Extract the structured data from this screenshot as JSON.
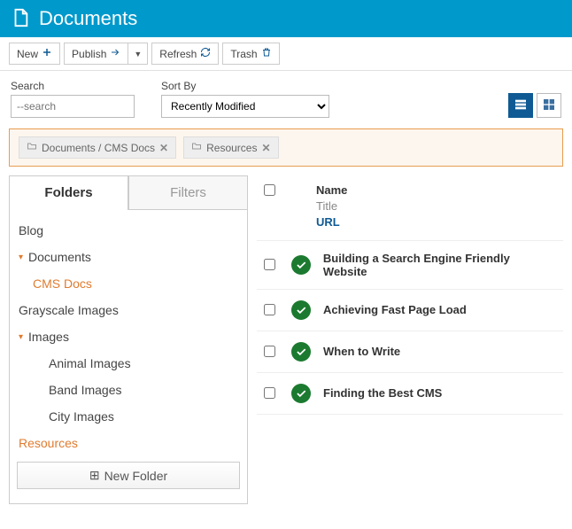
{
  "header": {
    "title": "Documents"
  },
  "toolbar": {
    "new": "New",
    "publish": "Publish",
    "refresh": "Refresh",
    "trash": "Trash"
  },
  "filters": {
    "search_label": "Search",
    "search_placeholder": "--search",
    "sort_label": "Sort By",
    "sort_value": "Recently Modified"
  },
  "chips": [
    "Documents / CMS Docs",
    "Resources"
  ],
  "tabs": {
    "folders": "Folders",
    "filters": "Filters"
  },
  "tree": {
    "blog": "Blog",
    "documents": "Documents",
    "cms_docs": "CMS Docs",
    "grayscale": "Grayscale Images",
    "images": "Images",
    "animal": "Animal Images",
    "band": "Band Images",
    "city": "City Images",
    "resources": "Resources",
    "new_folder": "New Folder"
  },
  "list": {
    "header": {
      "name": "Name",
      "title": "Title",
      "url": "URL"
    },
    "rows": [
      {
        "title": "Building a Search Engine Friendly Website"
      },
      {
        "title": "Achieving Fast Page Load"
      },
      {
        "title": "When to Write"
      },
      {
        "title": "Finding the Best CMS"
      }
    ]
  }
}
